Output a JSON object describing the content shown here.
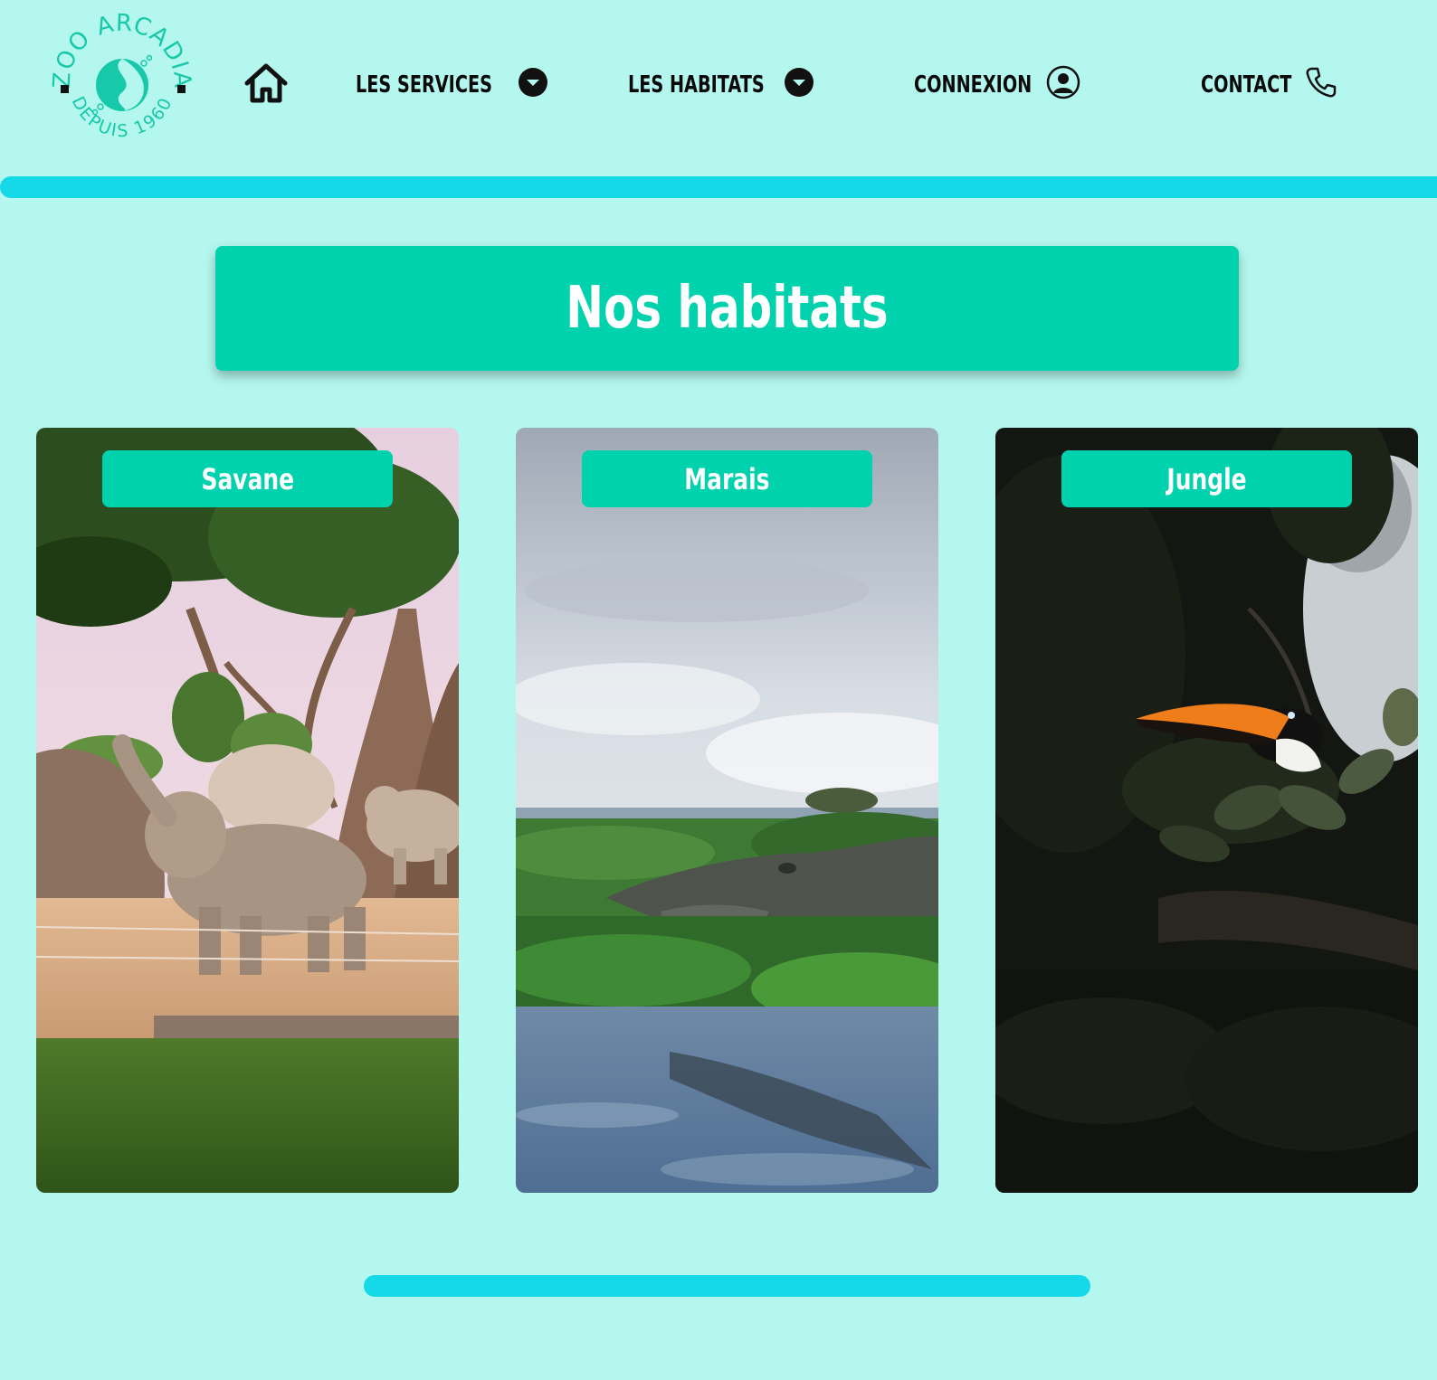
{
  "logo": {
    "top_text": "ZOO ARCADIA",
    "bottom_text": "DEPUIS 1960",
    "icon": "yin-yang-leaf-icon",
    "color": "#17c9a8"
  },
  "nav": {
    "home_icon": "home-icon",
    "items": [
      {
        "label": "LES SERVICES",
        "icon": "chevron-down-circle-icon"
      },
      {
        "label": "LES HABITATS",
        "icon": "chevron-down-circle-icon"
      },
      {
        "label": "CONNEXION",
        "icon": "user-circle-icon"
      },
      {
        "label": "CONTACT",
        "icon": "phone-icon"
      }
    ]
  },
  "main": {
    "title": "Nos habitats",
    "habitats": [
      {
        "name": "Savane",
        "image": "elephants-savanna-photo"
      },
      {
        "name": "Marais",
        "image": "crocodile-marsh-photo"
      },
      {
        "name": "Jungle",
        "image": "toucan-jungle-photo"
      }
    ]
  },
  "colors": {
    "background": "#b4f7ee",
    "accent": "#00d2ae",
    "divider": "#16d9e8",
    "text_dark": "#0a0a0a"
  }
}
